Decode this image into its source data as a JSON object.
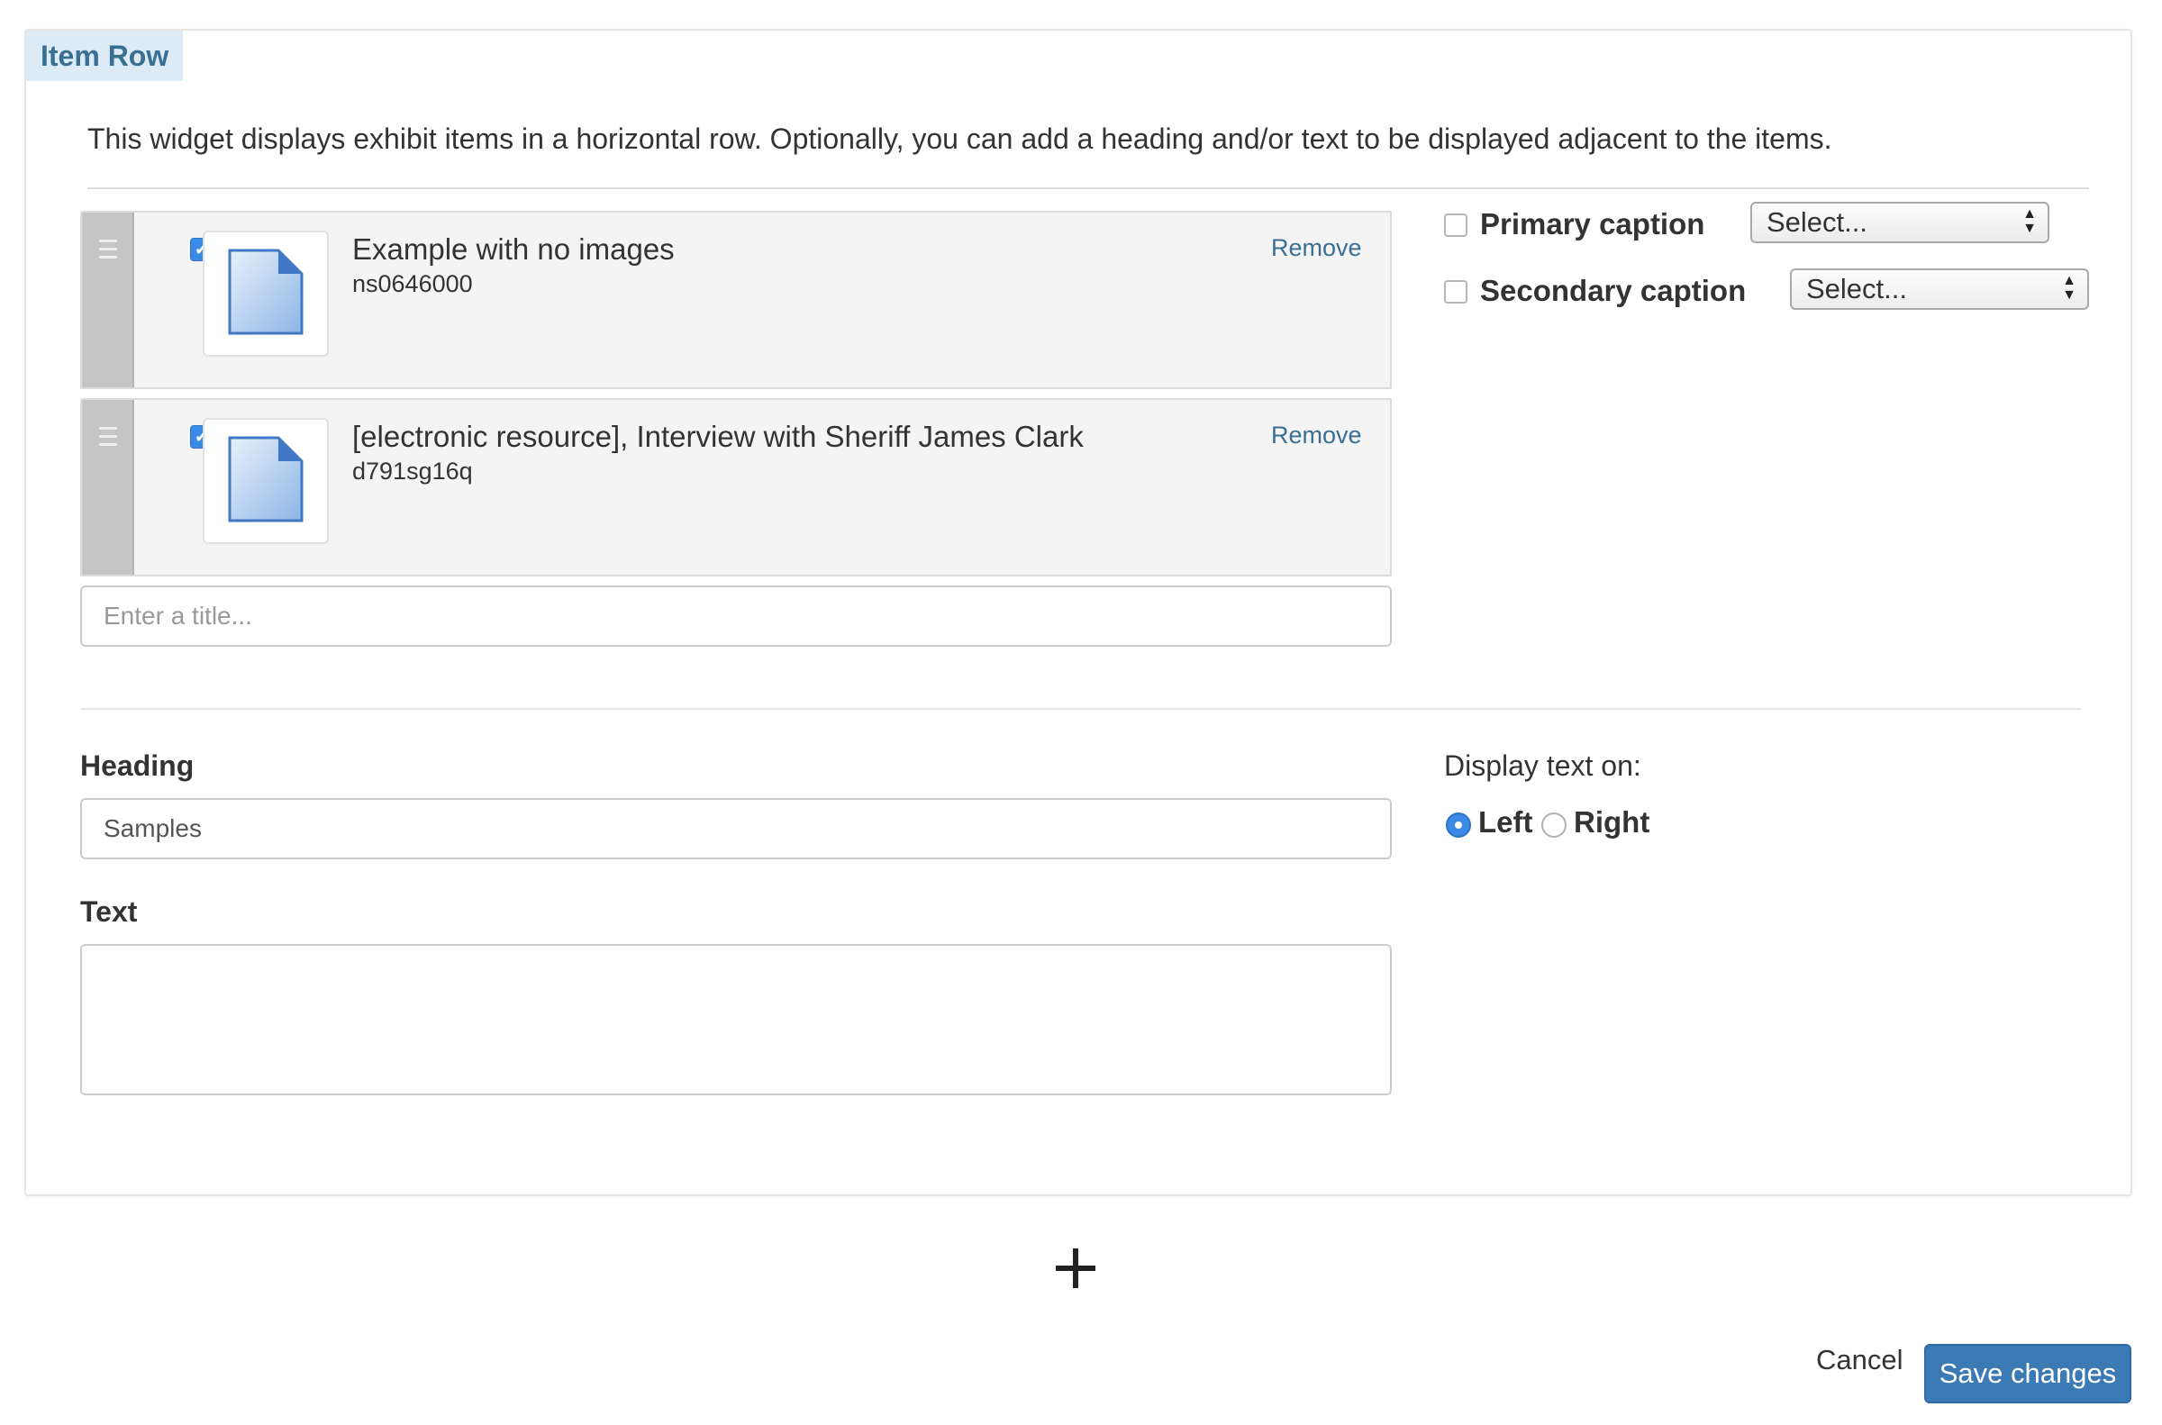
{
  "widget": {
    "label": "Item Row",
    "description": "This widget displays exhibit items in a horizontal row. Optionally, you can add a heading and/or text to be displayed adjacent to the items."
  },
  "items": [
    {
      "title": "Example with no images",
      "id": "ns0646000",
      "remove_label": "Remove",
      "checked": true
    },
    {
      "title": "[electronic resource], Interview with Sheriff James Clark",
      "id": "d791sg16q",
      "remove_label": "Remove",
      "checked": true
    }
  ],
  "title_input": {
    "placeholder": "Enter a title...",
    "value": ""
  },
  "captions": {
    "primary": {
      "label": "Primary caption",
      "select_value": "Select...",
      "checked": false
    },
    "secondary": {
      "label": "Secondary caption",
      "select_value": "Select...",
      "checked": false
    }
  },
  "heading": {
    "label": "Heading",
    "value": "Samples"
  },
  "text": {
    "label": "Text",
    "value": ""
  },
  "display": {
    "label": "Display text on:",
    "options": [
      {
        "label": "Left",
        "selected": true
      },
      {
        "label": "Right",
        "selected": false
      }
    ]
  },
  "actions": {
    "cancel_label": "Cancel",
    "save_label": "Save changes"
  },
  "colors": {
    "accent": "#3c7ab6",
    "link": "#3a6f94",
    "tag_bg": "#dcebf5"
  },
  "icons": {
    "item_thumb": "document-icon",
    "drag": "drag-handle-icon",
    "add": "plus-icon"
  }
}
